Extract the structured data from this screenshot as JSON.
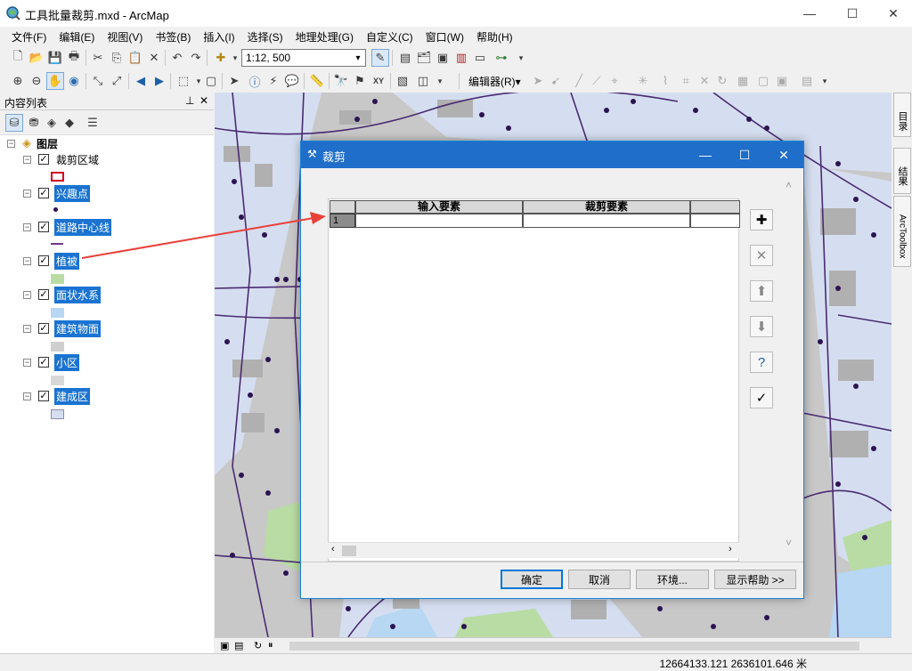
{
  "window": {
    "title": "工具批量裁剪.mxd - ArcMap"
  },
  "menu": [
    "文件(F)",
    "编辑(E)",
    "视图(V)",
    "书签(B)",
    "插入(I)",
    "选择(S)",
    "地理处理(G)",
    "自定义(C)",
    "窗口(W)",
    "帮助(H)"
  ],
  "toolbar": {
    "scale_value": "1:12, 500",
    "editor_label": "编辑器(R)▾"
  },
  "toc": {
    "title": "内容列表",
    "root_label": "图层",
    "layers": [
      {
        "name": "裁剪区域",
        "checked": true,
        "selected": false
      },
      {
        "name": "兴趣点",
        "checked": true,
        "selected": true
      },
      {
        "name": "道路中心线",
        "checked": true,
        "selected": true
      },
      {
        "name": "植被",
        "checked": true,
        "selected": true
      },
      {
        "name": "面状水系",
        "checked": true,
        "selected": true
      },
      {
        "name": "建筑物面",
        "checked": true,
        "selected": true
      },
      {
        "name": "小区",
        "checked": true,
        "selected": true
      },
      {
        "name": "建成区",
        "checked": true,
        "selected": true
      }
    ]
  },
  "side_tabs": [
    "目录",
    "结果",
    "ArcToolbox"
  ],
  "dialog": {
    "title": "裁剪",
    "columns": [
      "输入要素",
      "裁剪要素"
    ],
    "rows": [
      {
        "num": "1",
        "input": "",
        "clip": ""
      }
    ],
    "buttons": {
      "ok": "确定",
      "cancel": "取消",
      "env": "环境...",
      "help": "显示帮助 >>"
    }
  },
  "status": {
    "coords": "12664133.121  2636101.646 米"
  },
  "colors": {
    "accent": "#1f6ec9",
    "selection": "#1a73d1",
    "arrow": "#e8413a",
    "map_bg": "#c5c5c5",
    "water": "#b7d7f2",
    "vegetation": "#b8dca3",
    "road": "#4a2a72"
  }
}
